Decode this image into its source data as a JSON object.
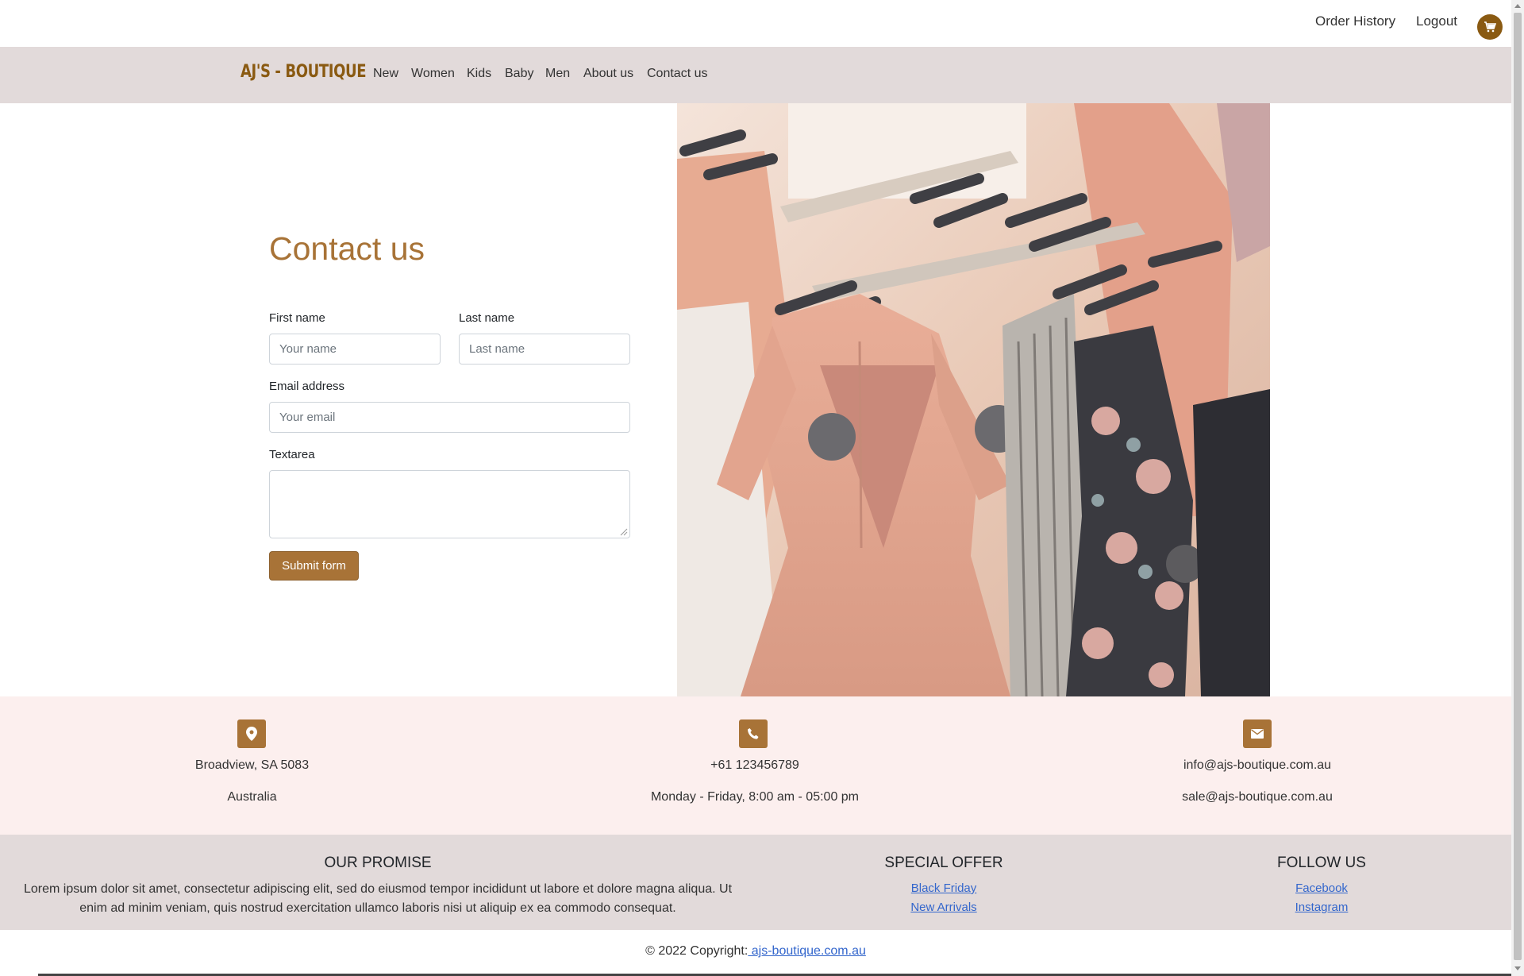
{
  "topbar": {
    "order_history": "Order History",
    "logout": "Logout",
    "cart_icon": "cart-icon"
  },
  "navbar": {
    "brand": "AJ'S - BOUTIQUE",
    "items": [
      {
        "label": "New"
      },
      {
        "label": "Women"
      },
      {
        "label": "Kids"
      },
      {
        "label": "Baby"
      },
      {
        "label": "Men"
      },
      {
        "label": "About us"
      },
      {
        "label": "Contact us"
      }
    ]
  },
  "form": {
    "title": "Contact us",
    "first_name_label": "First name",
    "first_name_placeholder": "Your name",
    "last_name_label": "Last name",
    "last_name_placeholder": "Last name",
    "email_label": "Email address",
    "email_placeholder": "Your email",
    "textarea_label": "Textarea",
    "submit_label": "Submit form"
  },
  "info": {
    "location": {
      "icon": "map-marker-icon",
      "line1": "Broadview, SA 5083",
      "line2": "Australia"
    },
    "phone": {
      "icon": "phone-icon",
      "line1": "+61 123456789",
      "line2": "Monday - Friday, 8:00 am - 05:00 pm"
    },
    "email": {
      "icon": "envelope-icon",
      "line1": "info@ajs-boutique.com.au",
      "line2": "sale@ajs-boutique.com.au"
    }
  },
  "footer": {
    "promise_title": "OUR PROMISE",
    "promise_text": "Lorem ipsum dolor sit amet, consectetur adipiscing elit, sed do eiusmod tempor incididunt ut labore et dolore magna aliqua. Ut enim ad minim veniam, quis nostrud exercitation ullamco laboris nisi ut aliquip ex ea commodo consequat.",
    "offer_title": "SPECIAL OFFER",
    "offer_links": [
      "Black Friday",
      "New Arrivals"
    ],
    "follow_title": "FOLLOW US",
    "follow_links": [
      "Facebook",
      "Instagram"
    ]
  },
  "copyright": {
    "text": "© 2022 Copyright:",
    "link": " ajs-boutique.com.au"
  },
  "colors": {
    "accent": "#a87337",
    "brand": "#8a5a12",
    "navbar_bg": "#e2dada",
    "info_bg": "#fcefee"
  }
}
